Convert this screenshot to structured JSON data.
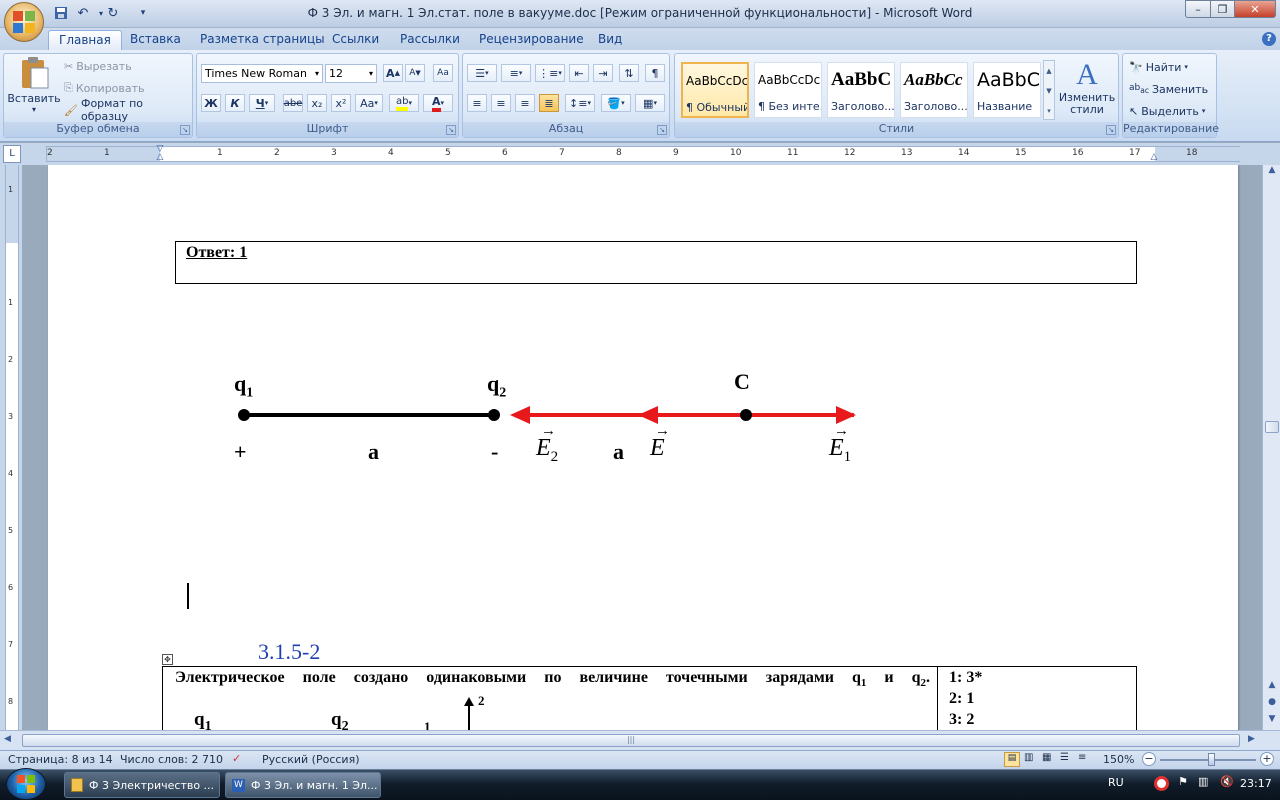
{
  "window": {
    "title": "Ф 3 Эл. и магн. 1 Эл.стат. поле в вакууме.doc [Режим ограниченной функциональности] - Microsoft Word"
  },
  "tabs": [
    "Главная",
    "Вставка",
    "Разметка страницы",
    "Ссылки",
    "Рассылки",
    "Рецензирование",
    "Вид"
  ],
  "clipboard": {
    "paste": "Вставить",
    "cut": "Вырезать",
    "copy": "Копировать",
    "format_painter": "Формат по образцу",
    "label": "Буфер обмена"
  },
  "font": {
    "name": "Times New Roman",
    "size": "12",
    "label": "Шрифт",
    "bold": "Ж",
    "italic": "К",
    "underline": "Ч",
    "strike": "abe",
    "sub": "x₂",
    "sup": "x²",
    "case": "Aa"
  },
  "paragraph": {
    "label": "Абзац"
  },
  "styles": {
    "label": "Стили",
    "items": [
      {
        "sample": "AaBbCcDc",
        "name": "¶ Обычный"
      },
      {
        "sample": "AaBbCcDc",
        "name": "¶ Без инте..."
      },
      {
        "sample": "AaBbC",
        "name": "Заголово..."
      },
      {
        "sample": "AaBbCc",
        "name": "Заголово..."
      },
      {
        "sample": "AaBbC",
        "name": "Название"
      }
    ],
    "change": "Изменить стили"
  },
  "editing": {
    "find": "Найти",
    "replace": "Заменить",
    "select": "Выделить",
    "label": "Редактирование"
  },
  "ruler": {
    "ticks": [
      "2",
      "1",
      "1",
      "2",
      "3",
      "4",
      "5",
      "6",
      "7",
      "8",
      "9",
      "10",
      "11",
      "12",
      "13",
      "14",
      "15",
      "16",
      "17",
      "18"
    ]
  },
  "vruler": {
    "ticks": [
      "1",
      "1",
      "2",
      "3",
      "4",
      "5",
      "6",
      "7",
      "8"
    ]
  },
  "document": {
    "answer": "Ответ: 1",
    "diagram": {
      "q1": "q",
      "q1_sub": "1",
      "q2": "q",
      "q2_sub": "2",
      "c": "C",
      "plus": "+",
      "minus": "-",
      "a1": "a",
      "a2": "a",
      "e2": "E",
      "e2_sub": "2",
      "e": "E",
      "e1": "E",
      "e1_sub": "1",
      "line_color": "#000000",
      "field_color": "#e8191b"
    },
    "section": "3.1.5-2",
    "question": {
      "text": "Электрическое поле создано одинаковыми по величине точечными зарядами",
      "q1": "q",
      "q1_sub": "1",
      "and": "и",
      "q2": "q",
      "q2_sub": "2",
      "period": ".",
      "fig_q1": "q",
      "fig_q1_sub": "1",
      "fig_q2": "q",
      "fig_q2_sub": "2",
      "fig_1": "1",
      "fig_2": "2"
    },
    "options": [
      "1: 3*",
      "2: 1",
      "3: 2"
    ]
  },
  "status": {
    "page": "Страница: 8 из 14",
    "words": "Число слов: 2 710",
    "lang": "Русский (Россия)",
    "zoom": "150%"
  },
  "taskbar": {
    "items": [
      "Ф 3 Электричество ...",
      "Ф 3 Эл. и магн. 1 Эл..."
    ],
    "lang": "RU",
    "time": "23:17"
  }
}
